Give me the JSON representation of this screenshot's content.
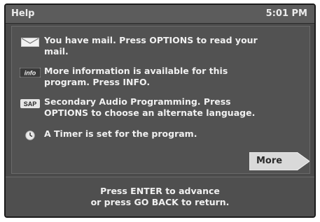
{
  "header": {
    "title": "Help",
    "time": "5:01 PM"
  },
  "items": [
    {
      "icon": "mail-envelope-icon",
      "text": "You have mail.  Press OPTIONS to read your\nmail."
    },
    {
      "icon": "info-icon",
      "icon_label": "info",
      "text": "More information is available for this\nprogram.  Press INFO."
    },
    {
      "icon": "sap-icon",
      "icon_label": "SAP",
      "text": "Secondary Audio Programming.  Press\nOPTIONS to choose an alternate language."
    },
    {
      "icon": "timer-icon",
      "text": "A Timer is set for the program."
    }
  ],
  "more_button": {
    "label": "More"
  },
  "footer": {
    "text": "Press ENTER to advance\nor press GO BACK to return."
  },
  "colors": {
    "panel_background": "#4a4a4a",
    "text": "#f0f0f0",
    "button": "#d9d9d9"
  }
}
